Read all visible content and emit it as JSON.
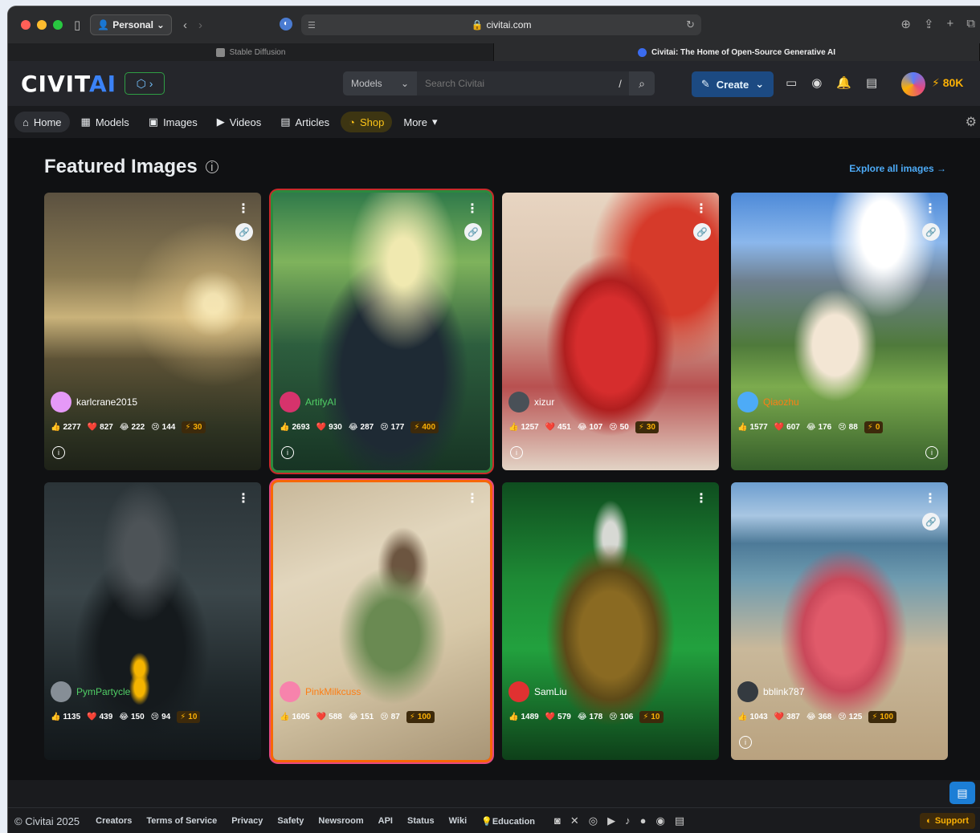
{
  "browser": {
    "profile": "Personal",
    "address": "civitai.com",
    "tabs": [
      {
        "title": "Stable Diffusion",
        "active": false
      },
      {
        "title": "Civitai: The Home of Open-Source Generative AI",
        "active": true
      }
    ]
  },
  "header": {
    "logo_main": "CIVIT",
    "logo_ai": "AI",
    "search_category": "Models",
    "search_placeholder": "Search Civitai",
    "search_shortcut": "/",
    "create_label": "Create",
    "buzz": "80K",
    "icons": [
      "monitor-icon",
      "eye-icon",
      "bell-icon",
      "chat-icon"
    ]
  },
  "nav": {
    "items": [
      {
        "label": "Home",
        "icon": "home-icon"
      },
      {
        "label": "Models",
        "icon": "grid-icon"
      },
      {
        "label": "Images",
        "icon": "image-icon"
      },
      {
        "label": "Videos",
        "icon": "video-icon"
      },
      {
        "label": "Articles",
        "icon": "article-icon"
      },
      {
        "label": "Shop",
        "icon": "shop-icon"
      },
      {
        "label": "More",
        "icon": "caret-down-icon"
      }
    ]
  },
  "main": {
    "title": "Featured Images",
    "explore_label": "Explore all images →",
    "cards": [
      {
        "user": "karlcrane2015",
        "likes": "2277",
        "hearts": "827",
        "laughs": "222",
        "cries": "144",
        "buzz": "30"
      },
      {
        "user": "ArtifyAI",
        "likes": "2693",
        "hearts": "930",
        "laughs": "287",
        "cries": "177",
        "buzz": "400"
      },
      {
        "user": "xizur",
        "likes": "1257",
        "hearts": "451",
        "laughs": "107",
        "cries": "50",
        "buzz": "30"
      },
      {
        "user": "Qiaozhu",
        "likes": "1577",
        "hearts": "607",
        "laughs": "176",
        "cries": "88",
        "buzz": "0"
      },
      {
        "user": "PymPartycle",
        "likes": "1135",
        "hearts": "439",
        "laughs": "150",
        "cries": "94",
        "buzz": "10"
      },
      {
        "user": "PinkMilkcuss",
        "likes": "1605",
        "hearts": "588",
        "laughs": "151",
        "cries": "87",
        "buzz": "100"
      },
      {
        "user": "SamLiu",
        "likes": "1489",
        "hearts": "579",
        "laughs": "178",
        "cries": "106",
        "buzz": "10"
      },
      {
        "user": "bblink787",
        "likes": "1043",
        "hearts": "387",
        "laughs": "368",
        "cries": "125",
        "buzz": "100"
      }
    ]
  },
  "footer": {
    "copyright": "© Civitai 2025",
    "links": [
      "Creators",
      "Terms of Service",
      "Privacy",
      "Safety",
      "Newsroom",
      "API",
      "Status",
      "Wiki",
      "Education"
    ],
    "support": "Support"
  },
  "colors": {
    "accent": "#3b82f6",
    "buzz": "#fab005",
    "shop": "#fcc419"
  }
}
